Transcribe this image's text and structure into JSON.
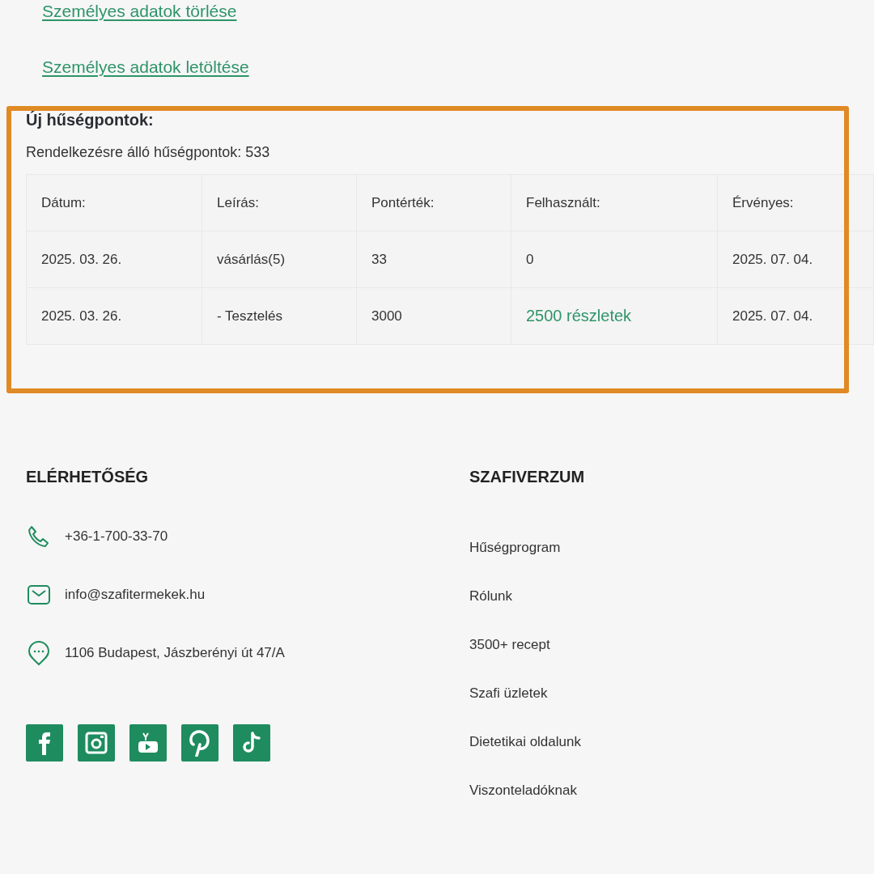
{
  "account_links": [
    {
      "label": "Személyes adatok törlése"
    },
    {
      "label": "Személyes adatok letöltése"
    }
  ],
  "loyalty": {
    "title": "Új hűségpontok:",
    "available": "Rendelkezésre álló hűségpontok: 533",
    "columns": [
      "Dátum:",
      "Leírás:",
      "Pontérték:",
      "Felhasznált:",
      "Érvényes:"
    ],
    "rows": [
      {
        "cells": [
          {
            "kind": "text",
            "text": "2025. 03. 26."
          },
          {
            "kind": "text",
            "text": "vásárlás(5)"
          },
          {
            "kind": "text",
            "text": "33"
          },
          {
            "kind": "text",
            "text": "0"
          },
          {
            "kind": "text",
            "text": "2025. 07. 04."
          }
        ]
      },
      {
        "cells": [
          {
            "kind": "text",
            "text": "2025. 03. 26."
          },
          {
            "kind": "text",
            "text": "- Tesztelés"
          },
          {
            "kind": "text",
            "text": "3000"
          },
          {
            "kind": "link",
            "text": "2500 részletek"
          },
          {
            "kind": "text",
            "text": "2025. 07. 04."
          }
        ]
      }
    ]
  },
  "footer": {
    "contact": {
      "title": "ELÉRHETŐSÉG",
      "items": [
        {
          "kind": "phone",
          "text": "+36-1-700-33-70"
        },
        {
          "kind": "email",
          "text": "info@szafitermekek.hu"
        },
        {
          "kind": "address",
          "text": "1106 Budapest, Jászberényi út 47/A"
        }
      ],
      "social": [
        {
          "kind": "facebook"
        },
        {
          "kind": "instagram"
        },
        {
          "kind": "youtube"
        },
        {
          "kind": "pinterest"
        },
        {
          "kind": "tiktok"
        }
      ]
    },
    "menu": {
      "title": "SZAFIVERZUM",
      "items": [
        "Hűségprogram",
        "Rólunk",
        "3500+ recept",
        "Szafi üzletek",
        "Dietetikai oldalunk",
        "Viszonteladóknak"
      ]
    }
  }
}
